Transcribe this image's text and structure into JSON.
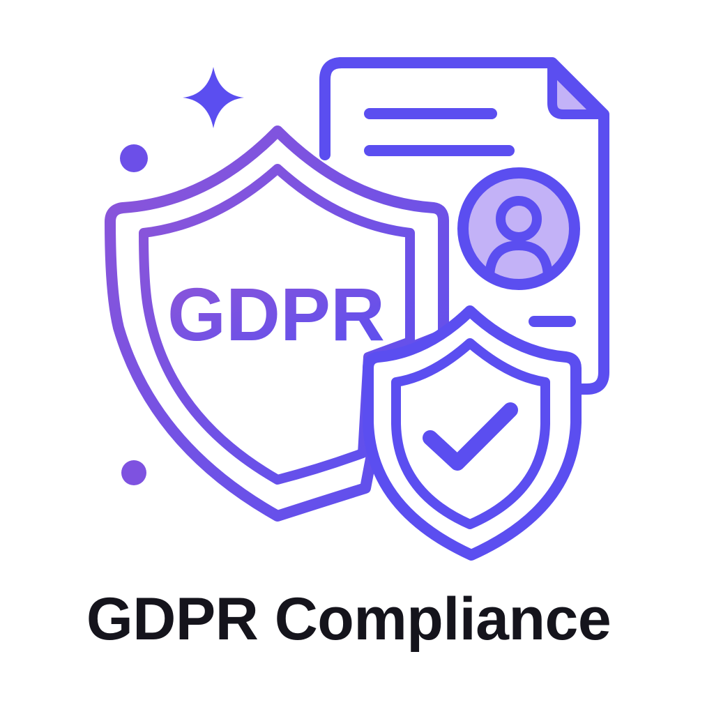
{
  "illustration": {
    "shield_label": "GDPR",
    "icons": [
      "sparkle-icon",
      "dot-icon",
      "shield-icon",
      "document-icon",
      "user-avatar-icon",
      "shield-check-icon",
      "checkmark-icon"
    ],
    "colors": {
      "stroke_start": "#8b55dc",
      "stroke_end": "#5b4ef0",
      "fill_light": "#c3b2f7",
      "caption": "#15141c",
      "background": "#ffffff"
    }
  },
  "caption": {
    "title": "GDPR Compliance"
  }
}
